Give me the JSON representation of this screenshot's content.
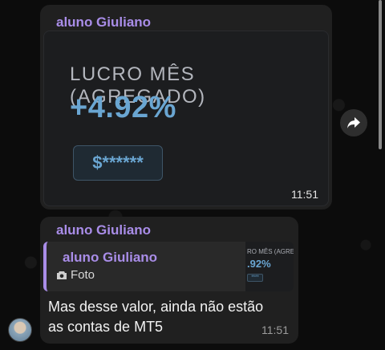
{
  "messages": [
    {
      "sender": "aluno Giuliano",
      "photo": {
        "title": "LUCRO MÊS (AGREGADO)",
        "value": "+4.92%",
        "masked_amount": "$******"
      },
      "time": "11:51"
    },
    {
      "sender": "aluno Giuliano",
      "reply": {
        "sender": "aluno Giuliano",
        "type_label": "Foto",
        "thumb_title": "RO MÊS (AGREG",
        "thumb_value": ".92%",
        "thumb_box": "****"
      },
      "text": "Mas desse valor, ainda não estão as contas de MT5",
      "time": "11:51"
    }
  ],
  "icons": {
    "forward": "forward-arrow-icon",
    "camera": "camera-icon"
  },
  "colors": {
    "sender": "#a98de8",
    "bubble": "#202020",
    "value": "#6aa6d2"
  }
}
